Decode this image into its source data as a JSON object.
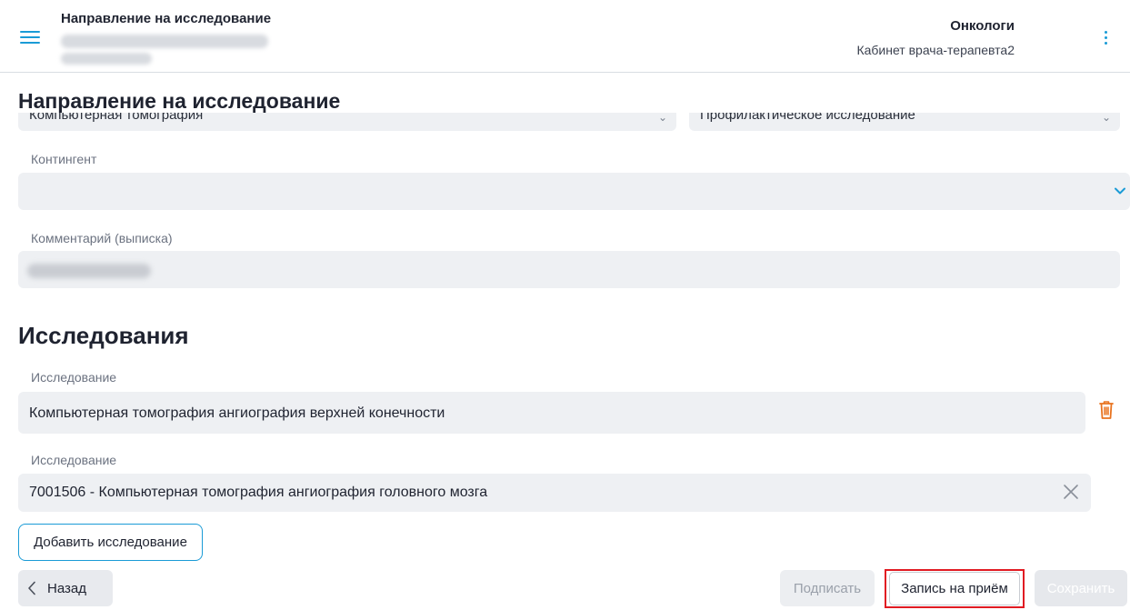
{
  "header": {
    "title": "Направление на исследование",
    "org": "Онкологи",
    "cabinet": "Кабинет врача-терапевта2"
  },
  "page": {
    "title": "Направление на исследование"
  },
  "top_fields": {
    "left_value": "Компьютерная томография",
    "right_value": "Профилактическое исследование"
  },
  "contingent": {
    "label": "Контингент",
    "value": ""
  },
  "comment": {
    "label": "Комментарий (выписка)"
  },
  "studies": {
    "title": "Исследования",
    "items": [
      {
        "label": "Исследование",
        "value": "Компьютерная томография ангиография верхней конечности"
      },
      {
        "label": "Исследование",
        "value": "7001506 - Компьютерная томография ангиография головного мозга"
      }
    ],
    "add_label": "Добавить исследование"
  },
  "footer": {
    "back_label": "Назад",
    "sign_label": "Подписать",
    "appointment_label": "Запись на приём",
    "save_label": "Сохранить"
  },
  "colors": {
    "accent": "#1a9bd6",
    "highlight": "#e11b22",
    "delete": "#e8731f"
  },
  "icons": [
    "menu-icon",
    "kebab-menu-icon",
    "chevron-down-icon",
    "trash-icon",
    "close-icon",
    "chevron-left-icon"
  ]
}
